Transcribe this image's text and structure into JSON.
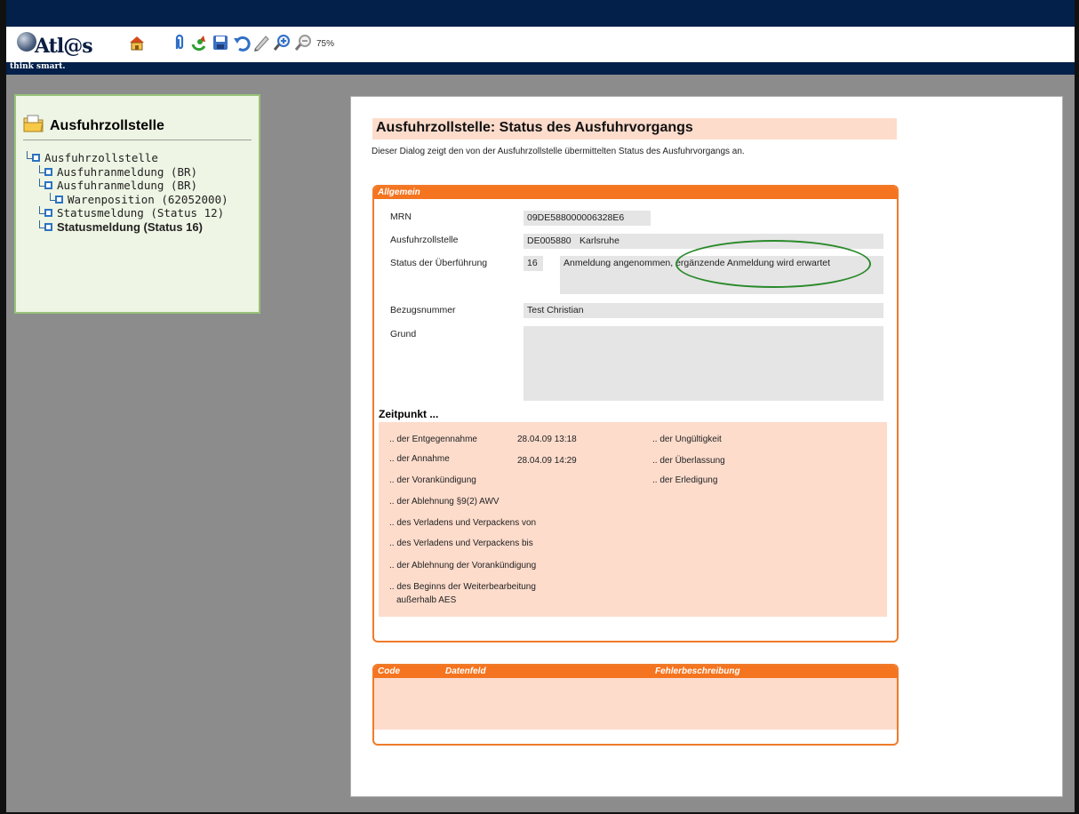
{
  "app": {
    "logo_text": "Atl@s",
    "tagline": "think smart.",
    "zoom": "75%"
  },
  "toolbar": {
    "icons": [
      "home-icon",
      "attachment-icon",
      "refresh-icon",
      "save-icon",
      "undo-icon",
      "edit-icon",
      "zoom-in-icon",
      "zoom-out-icon"
    ]
  },
  "sidebar": {
    "title": "Ausfuhrzollstelle",
    "tree": [
      {
        "label": "Ausfuhrzollstelle",
        "level": 0
      },
      {
        "label": "Ausfuhranmeldung  (BR)",
        "level": 1
      },
      {
        "label": "Ausfuhranmeldung  (BR)",
        "level": 1
      },
      {
        "label": "Warenposition (62052000)",
        "level": 2
      },
      {
        "label": "Statusmeldung (Status 12)",
        "level": 1
      },
      {
        "label": "Statusmeldung (Status 16)",
        "level": 1,
        "active": true
      }
    ]
  },
  "page": {
    "title": "Ausfuhrzollstelle: Status des Ausfuhrvorgangs",
    "description": "Dieser Dialog zeigt den von der Ausfuhrzollstelle übermittelten Status des Ausfuhrvorgangs an."
  },
  "allgemein": {
    "header": "Allgemein",
    "mrn_label": "MRN",
    "mrn_value": "09DE588000006328E6",
    "zollstelle_label": "Ausfuhrzollstelle",
    "zollstelle_code": "DE005880",
    "zollstelle_name": "Karlsruhe",
    "status_label": "Status der Überführung",
    "status_code": "16",
    "status_text": "Anmeldung angenommen, ergänzende Anmeldung wird erwartet",
    "bezug_label": "Bezugsnummer",
    "bezug_value": "Test Christian",
    "grund_label": "Grund",
    "grund_value": ""
  },
  "zeitpunkt": {
    "heading": "Zeitpunkt ...",
    "left": [
      {
        "label": ".. der Entgegennahme",
        "value": "28.04.09 13:18"
      },
      {
        "label": ".. der Annahme",
        "value": "28.04.09 14:29"
      },
      {
        "label": ".. der Vorankündigung",
        "value": ""
      },
      {
        "label": ".. der Ablehnung §9(2) AWV",
        "value": ""
      },
      {
        "label": ".. des Verladens und Verpackens von",
        "value": ""
      },
      {
        "label": ".. des Verladens und Verpackens bis",
        "value": ""
      },
      {
        "label": ".. der Ablehnung der Vorankündigung",
        "value": ""
      },
      {
        "label": ".. des Beginns der Weiterbearbeitung",
        "value": ""
      },
      {
        "label": "außerhalb AES",
        "value": ""
      }
    ],
    "right": [
      {
        "label": ".. der Ungültigkeit"
      },
      {
        "label": ".. der Überlassung"
      },
      {
        "label": ".. der Erledigung"
      }
    ]
  },
  "fehler": {
    "col_code": "Code",
    "col_datenfeld": "Datenfeld",
    "col_beschreibung": "Fehlerbeschreibung"
  },
  "colors": {
    "navy": "#03204a",
    "orange": "#f5741f",
    "peach": "#fddccc",
    "green_border": "#97c47a",
    "highlight": "#2a8a2a"
  }
}
